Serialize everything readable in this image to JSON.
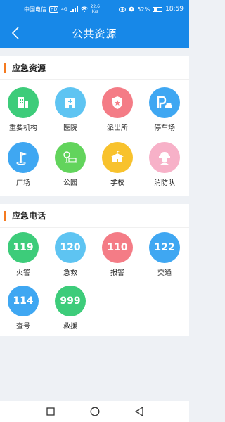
{
  "status_bar": {
    "carrier": "中国电信",
    "hd": "HD",
    "network": "4G",
    "speed_value": "22.6",
    "speed_unit": "K/s",
    "battery": "52%",
    "battery_level": 0.52,
    "time": "18:59"
  },
  "header": {
    "title": "公共资源"
  },
  "resources": {
    "title": "应急资源",
    "items": [
      {
        "label": "重要机构",
        "icon": "building-icon",
        "color": "#3dcc7a"
      },
      {
        "label": "医院",
        "icon": "hospital-icon",
        "color": "#5ec4f2"
      },
      {
        "label": "派出所",
        "icon": "police-badge-icon",
        "color": "#f47c86"
      },
      {
        "label": "停车场",
        "icon": "parking-icon",
        "color": "#3fa7f2"
      },
      {
        "label": "广场",
        "icon": "flag-icon",
        "color": "#3fa7f2"
      },
      {
        "label": "公园",
        "icon": "park-icon",
        "color": "#62d45c"
      },
      {
        "label": "学校",
        "icon": "school-icon",
        "color": "#f8c22d"
      },
      {
        "label": "消防队",
        "icon": "firefighter-icon",
        "color": "#f7b1c8"
      }
    ]
  },
  "phones": {
    "title": "应急电话",
    "items": [
      {
        "number": "119",
        "label": "火警",
        "color": "#3dcc7a"
      },
      {
        "number": "120",
        "label": "急救",
        "color": "#5ec4f2"
      },
      {
        "number": "110",
        "label": "报警",
        "color": "#f47c86"
      },
      {
        "number": "122",
        "label": "交通",
        "color": "#3fa7f2"
      },
      {
        "number": "114",
        "label": "查号",
        "color": "#3fa7f2"
      },
      {
        "number": "999",
        "label": "救援",
        "color": "#3dcc7a"
      }
    ]
  }
}
